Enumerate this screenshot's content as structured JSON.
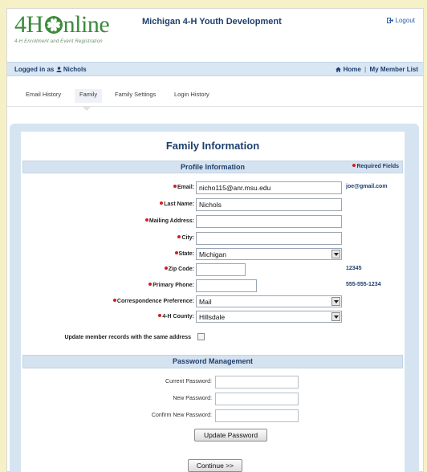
{
  "brand": {
    "logo_prefix": "4H",
    "logo_suffix": "nline",
    "tagline": "4-H Enrollment and Event Registration",
    "org_title": "Michigan 4-H Youth Development",
    "logout_label": "Logout"
  },
  "status": {
    "logged_in_prefix": "Logged in as",
    "username": "Nichols",
    "home_label": "Home",
    "separator": "|",
    "my_member_list_label": "My Member List"
  },
  "tabs": [
    {
      "label": "Email History",
      "active": false
    },
    {
      "label": "Family",
      "active": true
    },
    {
      "label": "Family Settings",
      "active": false
    },
    {
      "label": "Login History",
      "active": false
    }
  ],
  "panel": {
    "title": "Family Information"
  },
  "profile": {
    "section_title": "Profile Information",
    "required_note": "Required Fields",
    "fields": {
      "email": {
        "label": "Email:",
        "value": "nicho115@anr.msu.edu",
        "hint": "joe@gmail.com",
        "required": true
      },
      "last_name": {
        "label": "Last Name:",
        "value": "Nichols",
        "required": true
      },
      "mailing_address": {
        "label": "Mailing Address:",
        "value": "",
        "required": true
      },
      "city": {
        "label": "City:",
        "value": "",
        "required": true
      },
      "state": {
        "label": "State:",
        "value": "Michigan",
        "required": true
      },
      "zip": {
        "label": "Zip Code:",
        "value": "",
        "hint": "12345",
        "required": true
      },
      "phone": {
        "label": "Primary Phone:",
        "value": "",
        "hint": "555-555-1234",
        "required": true
      },
      "correspondence": {
        "label": "Correspondence Preference:",
        "value": "Mail",
        "required": true
      },
      "county": {
        "label": "4-H County:",
        "value": "Hillsdale",
        "required": true
      }
    },
    "update_records_label": "Update member records with the same address",
    "update_records_checked": false
  },
  "password": {
    "section_title": "Password Management",
    "current_label": "Current Password:",
    "new_label": "New Password:",
    "confirm_label": "Confirm New Password:",
    "update_button": "Update Password"
  },
  "continue_button": "Continue >>",
  "colors": {
    "brand_green": "#3c8a3a",
    "navy_text": "#1e3f6e",
    "link_blue": "#2a5ea8",
    "section_bar": "#d5e2ef",
    "outer_background": "#f6f0c6",
    "required_red": "#d21f1f"
  },
  "icons": [
    "clover-icon",
    "logout-icon",
    "user-icon",
    "home-icon",
    "dropdown-arrow-icon"
  ]
}
